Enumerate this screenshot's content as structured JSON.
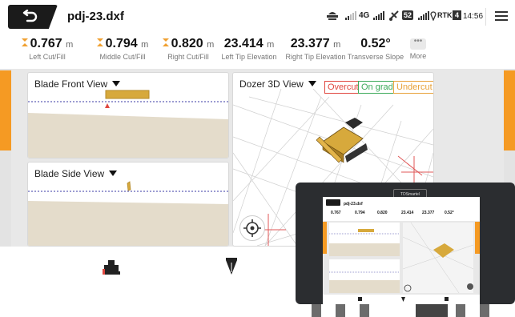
{
  "header": {
    "title": "pdj-23.dxf",
    "network": "4G",
    "battery": "52",
    "rtk_label": "RTK",
    "rtk_count": "4",
    "time": "14:56"
  },
  "metrics": [
    {
      "value": "0.767",
      "unit": "m",
      "label": "Left Cut/Fill",
      "icon": "cut-fill-icon"
    },
    {
      "value": "0.794",
      "unit": "m",
      "label": "Middle Cut/Fill",
      "icon": "cut-fill-icon"
    },
    {
      "value": "0.820",
      "unit": "m",
      "label": "Right Cut/Fill",
      "icon": "cut-fill-icon"
    },
    {
      "value": "23.414",
      "unit": "m",
      "label": "Left Tip Elevation"
    },
    {
      "value": "23.377",
      "unit": "m",
      "label": "Right Tip Elevation"
    },
    {
      "value": "0.52°",
      "unit": "",
      "label": "Transverse Slope"
    },
    {
      "value": "",
      "unit": "",
      "label": "More"
    }
  ],
  "panels": {
    "blade_front": {
      "title": "Blade Front View"
    },
    "blade_side": {
      "title": "Blade Side View"
    },
    "dozer_3d": {
      "title": "Dozer 3D View"
    }
  },
  "legend": {
    "overcut": "Overcut",
    "on_grade": "On grade",
    "undercut": "Undercut"
  },
  "colors": {
    "accent": "#f59a23",
    "overcut": "#e0473f",
    "on_grade": "#3daa5a",
    "undercut": "#e8a23a",
    "design_line": "#3a3aa5",
    "ground": "#e4dccb"
  },
  "device": {
    "logo": "TDSmartel",
    "mini_title": "pdj-23.dxf",
    "mini_values": [
      "0.767",
      "0.794",
      "0.820",
      "23.414",
      "23.377",
      "0.52°"
    ]
  }
}
